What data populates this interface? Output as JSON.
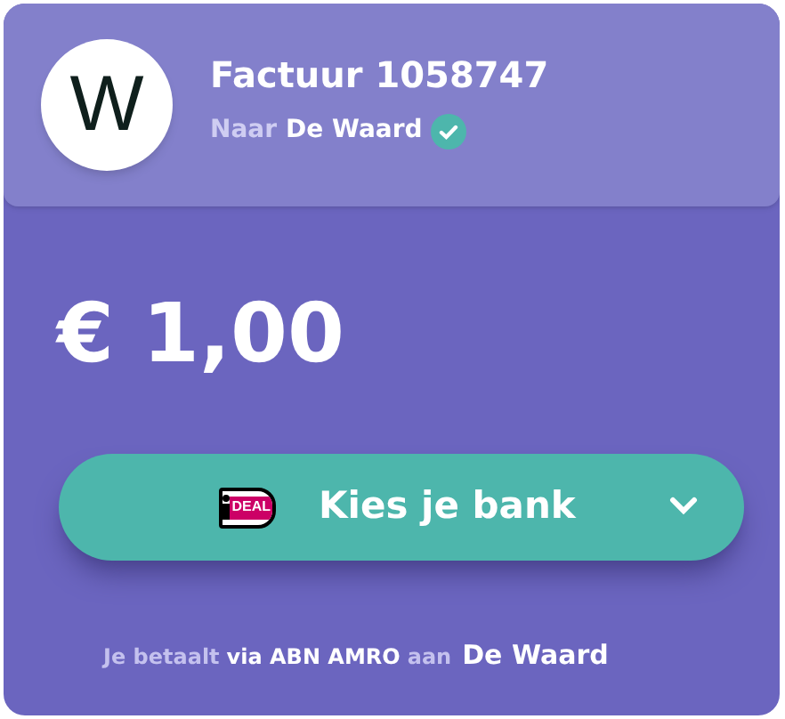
{
  "merchant": {
    "initial": "W",
    "title": "Factuur 1058747",
    "to_label": "Naar",
    "name": "De Waard",
    "verified": true
  },
  "amount": "€ 1,00",
  "bank_button": {
    "label": "Kies je bank",
    "logo": "DEAL"
  },
  "footer": [
    {
      "kind": "muted",
      "text": "Je betaalt"
    },
    {
      "kind": "strong",
      "text": "via ABN AMRO"
    },
    {
      "kind": "muted",
      "text": "aan"
    },
    {
      "kind": "name",
      "text": "De Waard"
    }
  ]
}
